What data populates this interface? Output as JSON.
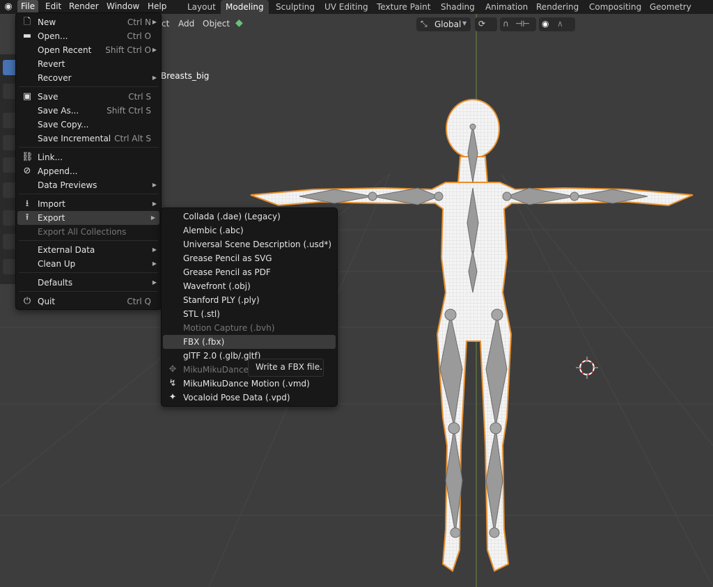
{
  "menubar": {
    "items": [
      "File",
      "Edit",
      "Render",
      "Window",
      "Help"
    ],
    "workspaces": [
      "Layout",
      "Modeling",
      "Sculpting",
      "UV Editing",
      "Texture Paint",
      "Shading",
      "Animation",
      "Rendering",
      "Compositing",
      "Geometry Nodes"
    ],
    "active_workspace": "Modeling"
  },
  "viewport_header": {
    "select_partial": "ct",
    "add": "Add",
    "object": "Object",
    "orientation": "Global"
  },
  "object_label": "Breasts_big",
  "file_menu": [
    {
      "label": "New",
      "shortcut": "Ctrl N",
      "arrow": true,
      "icon": "new-file-icon"
    },
    {
      "label": "Open...",
      "shortcut": "Ctrl O",
      "icon": "folder-icon"
    },
    {
      "label": "Open Recent",
      "shortcut": "Shift Ctrl O",
      "arrow": true
    },
    {
      "label": "Revert"
    },
    {
      "label": "Recover",
      "arrow": true
    },
    {
      "label": "Save",
      "shortcut": "Ctrl S",
      "icon": "save-icon"
    },
    {
      "label": "Save As...",
      "shortcut": "Shift Ctrl S"
    },
    {
      "label": "Save Copy..."
    },
    {
      "label": "Save Incremental",
      "shortcut": "Ctrl Alt S"
    },
    {
      "label": "Link...",
      "icon": "link-icon"
    },
    {
      "label": "Append...",
      "icon": "append-icon"
    },
    {
      "label": "Data Previews",
      "arrow": true
    },
    {
      "label": "Import",
      "arrow": true,
      "icon": "import-icon"
    },
    {
      "label": "Export",
      "arrow": true,
      "icon": "export-icon"
    },
    {
      "label": "Export All Collections",
      "disabled": true
    },
    {
      "label": "External Data",
      "arrow": true
    },
    {
      "label": "Clean Up",
      "arrow": true
    },
    {
      "label": "Defaults",
      "arrow": true
    },
    {
      "label": "Quit",
      "shortcut": "Ctrl Q",
      "icon": "power-icon"
    }
  ],
  "export_menu": [
    {
      "label": "Collada (.dae) (Legacy)"
    },
    {
      "label": "Alembic (.abc)"
    },
    {
      "label": "Universal Scene Description (.usd*)"
    },
    {
      "label": "Grease Pencil as SVG"
    },
    {
      "label": "Grease Pencil as PDF"
    },
    {
      "label": "Wavefront (.obj)"
    },
    {
      "label": "Stanford PLY (.ply)"
    },
    {
      "label": "STL (.stl)"
    },
    {
      "label": "Motion Capture (.bvh)",
      "disabled": true
    },
    {
      "label": "FBX (.fbx)",
      "highlighted": true
    },
    {
      "label": "glTF 2.0 (.glb/.gltf)"
    },
    {
      "label": "MikuMikuDance Model (.pmx)",
      "disabled": true,
      "icon": "mmd-model-icon"
    },
    {
      "label": "MikuMikuDance Motion (.vmd)",
      "icon": "mmd-motion-icon"
    },
    {
      "label": "Vocaloid Pose Data (.vpd)",
      "icon": "pose-data-icon"
    }
  ],
  "tooltip": "Write a FBX file.",
  "colors": {
    "accent": "#4772b3",
    "outline": "#e8902f"
  }
}
